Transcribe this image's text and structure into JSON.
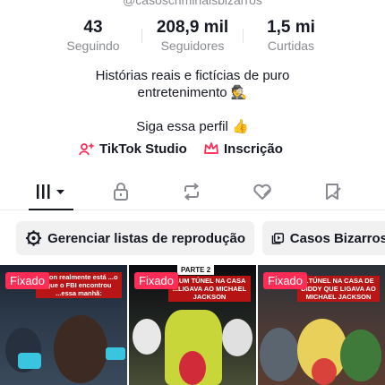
{
  "profile": {
    "handle": "@casoscriminaisbizarros"
  },
  "stats": {
    "following": {
      "value": "43",
      "label": "Seguindo"
    },
    "followers": {
      "value": "208,9 mil",
      "label": "Seguidores"
    },
    "likes": {
      "value": "1,5 mi",
      "label": "Curtidas"
    }
  },
  "bio": {
    "line1": "Histórias reais e fictícias de puro",
    "line2": "entretenimento 🕵️",
    "line3": "Siga essa perfil 👍"
  },
  "links": {
    "studio": "TikTok Studio",
    "subscription": "Inscrição"
  },
  "tabs": [
    {
      "icon": "videos-grid-icon",
      "selected": true
    },
    {
      "icon": "lock-icon",
      "selected": false
    },
    {
      "icon": "repost-icon",
      "selected": false
    },
    {
      "icon": "liked-heart-icon",
      "selected": false
    },
    {
      "icon": "saved-bookmark-icon",
      "selected": false
    }
  ],
  "playlists": {
    "manage_label": "Gerenciar listas de reprodução",
    "casos_label": "Casos Bizarros"
  },
  "videos": [
    {
      "pinned_label": "Fixado",
      "caption": "...son realmente está ...o que o FBI encontrou ...essa manhã:"
    },
    {
      "pinned_label": "Fixado",
      "badge": "PARTE 2",
      "caption": "...UM TÚNEL NA CASA ...LIGAVA AO MICHAEL JACKSON"
    },
    {
      "pinned_label": "Fixado",
      "caption": "...TÚNEL NA CASA DE DIDDY QUE LIGAVA AO MICHAEL JACKSON"
    }
  ],
  "colors": {
    "accent": "#ff2c55",
    "text": "#161823",
    "muted": "#8a8b91"
  }
}
